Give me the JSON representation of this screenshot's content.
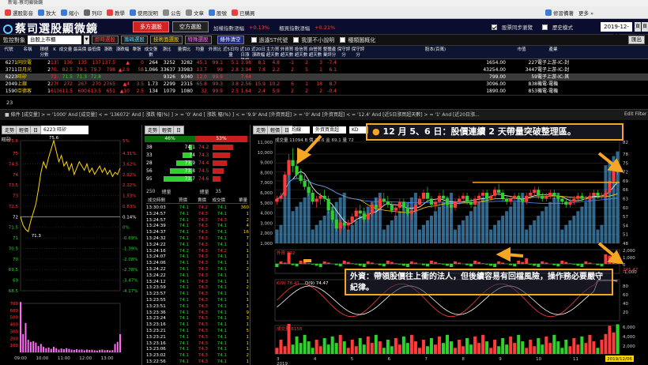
{
  "window": {
    "title": "新電-蔡司顯微鏡"
  },
  "toolbar": [
    {
      "label": "選股影音",
      "icon": "play-icon",
      "color": "#e84040"
    },
    {
      "label": "放大",
      "icon": "zoom-in-icon",
      "color": "#3a7bd5"
    },
    {
      "label": "縮小",
      "icon": "zoom-out-icon",
      "color": "#3a7bd5"
    },
    {
      "label": "列印",
      "icon": "print-icon",
      "color": "#666666"
    },
    {
      "label": "教學",
      "icon": "teach-icon",
      "color": "#e84040"
    },
    {
      "label": "使用說明",
      "icon": "help-icon",
      "color": "#3a7bd5"
    },
    {
      "label": "公告",
      "icon": "notice-icon",
      "color": "#888888"
    },
    {
      "label": "文章",
      "icon": "article-icon",
      "color": "#888888"
    },
    {
      "label": "股號",
      "icon": "ticker-icon",
      "color": "#3a7bd5"
    },
    {
      "label": "已購買",
      "icon": "cart-icon",
      "color": "#e84040"
    }
  ],
  "toolbar_right": {
    "label1": "修習備著",
    "label2": "更多 »"
  },
  "header": {
    "logo": "蔡司選股顯微鏡",
    "mode_multi": "多方選股",
    "mode_short": "空方選股",
    "index": [
      {
        "label": "加權指數漲幅",
        "value": "+0.13%"
      },
      {
        "label": "櫃買指數漲幅",
        "value": "+0.21%"
      }
    ],
    "sync_check": "股票同步瀏覽",
    "history_check": "歷史模式",
    "date": "2019-12-06",
    "pages": [
      "頁1",
      "頁2"
    ]
  },
  "filterbar": {
    "monitor_label": "監控對象",
    "monitor_value": "台股上市櫃",
    "buttons": [
      "即時選股",
      "籌碼選股",
      "技術面選股",
      "特殊選股",
      "條件清空"
    ],
    "checks": [
      "過濾ST代號",
      "我還不小說明",
      "種類圖概化"
    ],
    "side_btn": "匯出"
  },
  "table": {
    "columns": [
      "代號",
      "名稱",
      "積極分數",
      "K",
      "成交量",
      "最高價",
      "最低價",
      "漲跌",
      "漲跌幅",
      "單張",
      "成交張數",
      "漲比",
      "量價比",
      "均量",
      "外資比",
      "近5日均量",
      "近10日漲跌幅",
      "近20日漲跌幅",
      "主力買超天數",
      "外資買超天數",
      "投信買超天數",
      "自營買超天數",
      "整體產業評分",
      "保守評分",
      "保守評分",
      "股本(百萬)",
      "市值",
      "產業"
    ],
    "rows": [
      [
        "6271",
        "同欣電",
        "2",
        "137",
        "136",
        "135",
        "137",
        "137.5",
        "▲",
        "0",
        "264",
        "3252",
        "3282",
        "45.1",
        "99.1",
        "5.1",
        "3.98",
        "8.1",
        "4.8",
        "-1",
        "2",
        "3",
        "-7.4",
        "",
        "",
        "1654.00",
        "227",
        "電子上游-IC-封測"
      ],
      [
        "3711",
        "日月光",
        "2",
        "70.2",
        "82.5",
        "79.1",
        "79.7",
        "798",
        "▲2.9",
        "58",
        "1.066",
        "33637",
        "33983",
        "13.7",
        "99",
        "2.8",
        "3.94",
        "7.8",
        "2.2",
        "2",
        "5",
        "1",
        "6.1",
        "",
        "",
        "43254.00",
        "3447",
        "電子上游-IC-封測"
      ],
      [
        "6223",
        "旺矽",
        "",
        "72.0",
        "71.5",
        "71.3",
        "72.8",
        "",
        "",
        "",
        "",
        "9326",
        "9340",
        "12.0",
        "99.9",
        "",
        "7.64",
        "",
        "",
        "",
        "",
        "",
        "",
        "",
        "",
        "799.00",
        "59",
        "電子上游-IC-其他"
      ],
      [
        "2049",
        "上銀",
        "2",
        "270.5",
        "272",
        "267",
        "270",
        "2765",
        "▲4",
        "3.5",
        "1.73",
        "2299",
        "2315",
        "65.8",
        "99.3",
        "3.8",
        "2.56",
        "15.9",
        "10.2",
        "6",
        "1",
        "18",
        "8.7",
        "",
        "",
        "3096.00",
        "838",
        "機電-電機"
      ],
      [
        "1590",
        "亞德客",
        "1",
        "611.5",
        "611.5",
        "600",
        "613.5",
        "651",
        "▲10",
        "2.5",
        "134",
        "1079",
        "1080",
        "32",
        "99.9",
        "2.5",
        "1.64",
        "2.4",
        "5.9",
        "2",
        "2",
        "2",
        "-0.4",
        "",
        "",
        "1890.00",
        "853",
        "機電-電機"
      ]
    ]
  },
  "count": {
    "value": "23"
  },
  "conditions": "■ 條件 [成交量] > = '1000' And [成交量] < = '136072' And [ 漲跌 幅(%) ] > = '0' And [ 漲跌 幅(%) ] < = '9.9' And [外資買超] > = '0' And [外資買超] < = '12.4' And [近5日漲買超天數] > = '1' And [近20日漲...",
  "edit_filter": "Edit Filter",
  "intraday": {
    "tabs": [
      "走勢",
      "輕價",
      "日"
    ],
    "symbol": "6223 旺矽",
    "name": "旺矽",
    "y_left": [
      "75.6",
      "75",
      "74.5",
      "74",
      "73.5",
      "73",
      "72.5",
      "72",
      "71.5",
      "71",
      "70.5",
      "70",
      "69.5",
      "69",
      "68.5"
    ],
    "y_right": [
      "5%",
      "4.31%",
      "3.62%",
      "2.92%",
      "2.22%",
      "1.53%",
      "0.83%",
      "0.14%",
      "0%",
      "-0.69%",
      "-1.39%",
      "-2.08%",
      "-2.78%",
      "-3.47%",
      "-4.17%"
    ],
    "high": "75.6",
    "low": "71.3",
    "ref": "72",
    "vol_ticks": [
      "700",
      "600",
      "500",
      "400",
      "300",
      "200",
      "100"
    ],
    "time_ticks": [
      "09:00",
      "10:00",
      "11:00",
      "12:00",
      "13:00"
    ],
    "price": [
      72,
      71.6,
      71.4,
      71.3,
      71.8,
      72.2,
      72.6,
      73.3,
      74.1,
      74.6,
      74.3,
      74.8,
      75.2,
      75.6,
      75.1,
      74.6,
      74.9,
      74.4,
      74.6,
      74.2,
      74.5,
      74.0,
      74.3,
      74.6,
      74.4,
      74.2,
      74.5,
      74.1,
      74.3,
      74.0,
      74.2,
      74.4,
      74.1,
      74.3,
      74.0,
      74.2,
      73.9,
      74.1,
      74.0,
      74.3
    ],
    "volume": [
      720,
      260,
      420,
      180,
      150,
      160,
      140,
      90,
      120,
      80,
      60,
      70,
      50,
      80,
      60,
      40,
      55,
      45,
      60,
      50,
      40,
      35,
      45,
      38,
      42,
      30,
      40,
      35,
      38,
      30,
      25,
      36,
      40,
      30,
      35,
      28,
      32,
      120,
      150,
      260
    ]
  },
  "orderbook": {
    "pct_buy": "46%",
    "pct_sell": "53%",
    "buy_qty": [
      "38",
      "33",
      "28",
      "56",
      "95"
    ],
    "buy_price": [
      "74.1",
      "74",
      "73.9",
      "73.8",
      "73.7"
    ],
    "sell_price": [
      "74.2",
      "74.3",
      "74.4",
      "74.5",
      "74.6"
    ],
    "sell_qty": [
      "",
      "",
      "",
      "",
      ""
    ],
    "stats": [
      "250",
      "總量",
      "總量",
      "35"
    ],
    "tick_header": [
      "成交時間",
      "買價",
      "賣價",
      "成交價",
      "單量"
    ],
    "ticks": [
      [
        "13:30:03",
        "74.1",
        "74.2",
        "74.1",
        "360"
      ],
      [
        "13:24:57",
        "74.1",
        "74.3",
        "74.1",
        "1"
      ],
      [
        "13:24:57",
        "74.1",
        "74.3",
        "74.3",
        "2"
      ],
      [
        "13:24:39",
        "74.1",
        "74.3",
        "74.1",
        "4"
      ],
      [
        "13:24:37",
        "74.1",
        "74.3",
        "74.1",
        "16"
      ],
      [
        "13:24:32",
        "74.1",
        "74.3",
        "74.1",
        "7"
      ],
      [
        "13:24:22",
        "74.1",
        "74.3",
        "74.1",
        "1"
      ],
      [
        "13:24:16",
        "74.2",
        "74.3",
        "74.2",
        "1"
      ],
      [
        "13:24:07",
        "74.1",
        "74.3",
        "74.1",
        "1"
      ],
      [
        "13:24:06",
        "74.1",
        "74.3",
        "74.1",
        "1"
      ],
      [
        "13:24:22",
        "74.1",
        "74.3",
        "74.1",
        "2"
      ],
      [
        "13:24:22",
        "74.1",
        "74.3",
        "74.1",
        "1"
      ],
      [
        "13:24:12",
        "74.1",
        "74.3",
        "74.1",
        "1"
      ],
      [
        "13:23:59",
        "74.1",
        "74.3",
        "74.1",
        "2"
      ],
      [
        "13:23:57",
        "74.1",
        "74.3",
        "74.1",
        "1"
      ],
      [
        "13:23:55",
        "74.1",
        "74.3",
        "74.1",
        "1"
      ],
      [
        "13:23:51",
        "74.1",
        "74.3",
        "74.1",
        "1"
      ],
      [
        "13:23:36",
        "74.1",
        "74.3",
        "74.1",
        "9"
      ],
      [
        "13:23:24",
        "74.1",
        "74.3",
        "74.1",
        "3"
      ],
      [
        "13:23:16",
        "74.1",
        "74.3",
        "74.1",
        "1"
      ],
      [
        "13:23:21",
        "74.1",
        "74.3",
        "74.1",
        "5"
      ],
      [
        "13:23:21",
        "74.1",
        "74.3",
        "74.1",
        "1"
      ],
      [
        "13:23:16",
        "74.1",
        "74.3",
        "74.1",
        "1"
      ],
      [
        "13:23:06",
        "74.1",
        "74.3",
        "74.1",
        "1"
      ],
      [
        "13:23:02",
        "74.1",
        "74.3",
        "74.1",
        "2"
      ],
      [
        "13:22:56",
        "74.1",
        "74.3",
        "74.1",
        "1"
      ]
    ]
  },
  "daily": {
    "tabs": [
      "走勢",
      "輕價",
      "日"
    ],
    "sel1": "均線",
    "sel2": "外資買賣超",
    "sel3": "KD",
    "info": "成交量 11094 B 價 73.6 金 69.1 量 72",
    "y_price": [
      "82",
      "78",
      "75",
      "72",
      "69",
      "66",
      "63",
      "60",
      "57",
      "54",
      "51",
      "48"
    ],
    "y_vol": [
      "11,000",
      "10,000",
      "9,000",
      "8,000",
      "7,000",
      "6,000",
      "5,000",
      "4,000",
      "3,000",
      "2,000",
      "1,000"
    ],
    "foreign_label": "外資 792",
    "foreign_val": "245.47",
    "foreign_ticks": [
      "2,000",
      "1,000",
      "0",
      "-1,000"
    ],
    "kd_label": "K(9) 78.41",
    "d_label": "D(9) 74.47",
    "kd_ticks": [
      "80",
      "60",
      "40",
      "20"
    ],
    "sub_vol_label": "成交量 6158",
    "sub_vol_ticks": [
      "6,000",
      "4,000",
      "2,000"
    ],
    "months": [
      "3",
      "4",
      "5",
      "6",
      "7",
      "8",
      "9",
      "10",
      "11"
    ],
    "year": "2019",
    "last_date": "2019/12/06",
    "candles": [
      [
        62,
        64,
        61,
        63
      ],
      [
        63,
        65,
        62,
        64
      ],
      [
        64,
        72,
        63,
        71
      ],
      [
        71,
        78,
        70,
        76
      ],
      [
        76,
        80,
        72,
        74
      ],
      [
        74,
        76,
        70,
        71
      ],
      [
        71,
        73,
        68,
        69
      ],
      [
        69,
        71,
        66,
        67
      ],
      [
        67,
        69,
        64,
        65
      ],
      [
        65,
        66,
        61,
        62
      ],
      [
        62,
        64,
        60,
        63
      ],
      [
        63,
        65,
        61,
        64
      ],
      [
        64,
        66,
        62,
        63
      ],
      [
        63,
        64,
        58,
        59
      ],
      [
        59,
        61,
        55,
        56
      ],
      [
        56,
        58,
        52,
        53
      ],
      [
        53,
        56,
        51,
        55
      ],
      [
        55,
        57,
        53,
        54
      ],
      [
        54,
        56,
        52,
        55
      ],
      [
        55,
        58,
        54,
        57
      ],
      [
        57,
        60,
        56,
        59
      ],
      [
        59,
        61,
        57,
        58
      ],
      [
        58,
        60,
        55,
        56
      ],
      [
        56,
        59,
        55,
        58
      ],
      [
        58,
        62,
        57,
        61
      ],
      [
        61,
        63,
        59,
        60
      ],
      [
        60,
        64,
        59,
        63
      ],
      [
        63,
        65,
        61,
        62
      ],
      [
        62,
        64,
        60,
        61
      ],
      [
        61,
        62,
        58,
        59
      ],
      [
        59,
        61,
        57,
        60
      ],
      [
        60,
        63,
        59,
        62
      ],
      [
        62,
        63,
        59,
        60
      ],
      [
        60,
        61,
        57,
        58
      ],
      [
        58,
        60,
        56,
        59
      ],
      [
        59,
        62,
        58,
        61
      ],
      [
        61,
        64,
        60,
        63
      ],
      [
        63,
        66,
        62,
        65
      ],
      [
        65,
        67,
        62,
        63
      ],
      [
        63,
        64,
        60,
        61
      ],
      [
        61,
        63,
        59,
        62
      ],
      [
        62,
        65,
        61,
        64
      ],
      [
        64,
        66,
        62,
        63
      ],
      [
        63,
        64,
        60,
        61
      ],
      [
        61,
        62,
        58,
        60
      ],
      [
        60,
        63,
        59,
        62
      ],
      [
        62,
        64,
        61,
        63
      ],
      [
        63,
        65,
        62,
        64
      ],
      [
        64,
        65,
        61,
        62
      ],
      [
        62,
        63,
        60,
        61
      ],
      [
        61,
        64,
        60,
        63
      ],
      [
        63,
        65,
        61,
        64
      ],
      [
        64,
        66,
        63,
        65
      ],
      [
        65,
        66,
        62,
        63
      ],
      [
        63,
        65,
        62,
        64
      ],
      [
        64,
        67,
        63,
        66
      ],
      [
        66,
        68,
        64,
        65
      ],
      [
        65,
        66,
        62,
        63
      ],
      [
        63,
        64,
        61,
        62
      ],
      [
        62,
        64,
        61,
        63
      ],
      [
        63,
        65,
        62,
        64
      ],
      [
        64,
        65,
        62,
        63
      ],
      [
        63,
        64,
        61,
        62
      ],
      [
        62,
        65,
        61,
        64
      ],
      [
        64,
        66,
        63,
        65
      ],
      [
        65,
        67,
        64,
        66
      ],
      [
        66,
        67,
        63,
        64
      ],
      [
        64,
        65,
        62,
        63
      ],
      [
        63,
        65,
        62,
        64
      ],
      [
        64,
        66,
        63,
        65
      ],
      [
        65,
        66,
        63,
        64
      ],
      [
        64,
        65,
        62,
        63
      ],
      [
        63,
        64,
        61,
        62
      ],
      [
        62,
        63,
        60,
        61
      ],
      [
        61,
        63,
        60,
        62
      ],
      [
        62,
        64,
        61,
        63
      ],
      [
        63,
        65,
        62,
        64
      ],
      [
        64,
        65,
        62,
        63
      ],
      [
        63,
        64,
        62,
        63
      ],
      [
        63,
        65,
        62,
        64
      ],
      [
        64,
        66,
        63,
        65
      ],
      [
        65,
        66,
        63,
        64
      ],
      [
        64,
        65,
        63,
        64
      ],
      [
        64,
        66,
        63,
        65
      ],
      [
        65,
        70,
        64,
        69
      ],
      [
        69,
        74,
        68,
        73
      ],
      [
        73,
        75,
        71,
        72
      ]
    ]
  },
  "callouts": {
    "top": "12 月 5、6 日：股價連續 2 天帶量突破整理區。",
    "bottom": "外資：帶領股價往上衝的法人，但後續容易有回檔風險，操作務必要嚴守紀律。"
  }
}
